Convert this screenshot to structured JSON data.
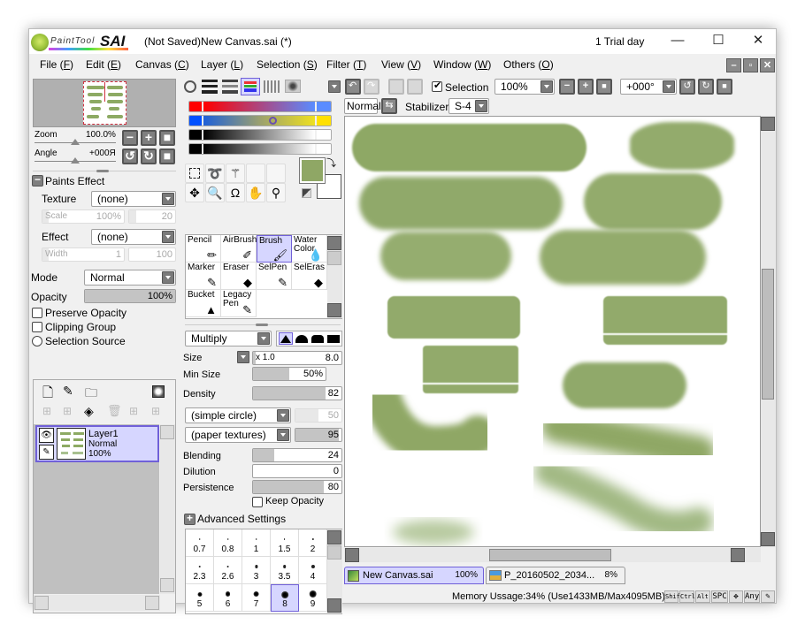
{
  "app": {
    "logo_text": "PaintTool",
    "logo_brand": "SAI",
    "title": "(Not Saved)New Canvas.sai (*)",
    "trial": "1 Trial day",
    "window_controls": {
      "minimize": "—",
      "maximize": "☐",
      "close": "✕"
    }
  },
  "menu": [
    {
      "label": "File",
      "key": "F"
    },
    {
      "label": "Edit",
      "key": "E"
    },
    {
      "label": "Canvas",
      "key": "C"
    },
    {
      "label": "Layer",
      "key": "L"
    },
    {
      "label": "Selection",
      "key": "S"
    },
    {
      "label": "Filter",
      "key": "T"
    },
    {
      "label": "View",
      "key": "V"
    },
    {
      "label": "Window",
      "key": "W"
    },
    {
      "label": "Others",
      "key": "O"
    }
  ],
  "navigator": {
    "zoom_label": "Zoom",
    "zoom_value": "100.0%",
    "angle_label": "Angle",
    "angle_value": "+000Я"
  },
  "paint_effect": {
    "header": "Paints Effect",
    "texture_label": "Texture",
    "texture_value": "(none)",
    "scale_label": "Scale",
    "scale_value": "100%",
    "scale_strength": "20",
    "effect_label": "Effect",
    "effect_value": "(none)",
    "width_label": "Width",
    "width_value": "1",
    "width_strength": "100"
  },
  "layer_props": {
    "mode_label": "Mode",
    "mode_value": "Normal",
    "opacity_label": "Opacity",
    "opacity_value": "100%",
    "opacity_fraction": 1.0,
    "preserve_opacity": "Preserve Opacity",
    "clipping_group": "Clipping Group",
    "selection_source": "Selection Source"
  },
  "layers": [
    {
      "name": "Layer1",
      "mode": "Normal",
      "opacity": "100%",
      "selected": true
    }
  ],
  "color": {
    "current": "#8fa765",
    "background": "#ffffff",
    "sliders": [
      {
        "left": "#ff0000",
        "right": "#5a8cff"
      },
      {
        "left": "#0050ff",
        "right": "#ffe000"
      },
      {
        "left": "#000000",
        "right": "#ffffff"
      },
      {
        "left": "#000000",
        "right": "#ffffff"
      }
    ]
  },
  "brush_tools": [
    {
      "label": "Pencil",
      "icon": "pencil-icon",
      "glyph": "✏"
    },
    {
      "label": "AirBrush",
      "icon": "airbrush-icon",
      "glyph": "✐"
    },
    {
      "label": "Brush",
      "icon": "brush-icon",
      "glyph": "🖌",
      "active": true
    },
    {
      "label": "Water Color",
      "icon": "watercolor-icon",
      "glyph": "💧"
    },
    {
      "label": "Marker",
      "icon": "marker-icon",
      "glyph": "✎"
    },
    {
      "label": "Eraser",
      "icon": "eraser-icon",
      "glyph": "◆"
    },
    {
      "label": "SelPen",
      "icon": "selpen-icon",
      "glyph": "✎"
    },
    {
      "label": "SelEras",
      "icon": "seleraser-icon",
      "glyph": "◆"
    },
    {
      "label": "Bucket",
      "icon": "bucket-icon",
      "glyph": "▲"
    },
    {
      "label": "Legacy Pen",
      "icon": "legacy-pen-icon",
      "glyph": "✎"
    }
  ],
  "brush_settings": {
    "blend_mode": "Multiply",
    "size_label": "Size",
    "size_multiplier": "x 1.0",
    "size_value": "8.0",
    "min_size_label": "Min Size",
    "min_size_value": "50%",
    "min_size_fraction": 0.5,
    "density_label": "Density",
    "density_value": "82",
    "density_fraction": 0.82,
    "shape_value": "(simple circle)",
    "shape_strength": "50",
    "texture_value": "(paper textures)",
    "texture_strength": "95",
    "blending_label": "Blending",
    "blending_value": "24",
    "blending_fraction": 0.24,
    "dilution_label": "Dilution",
    "dilution_value": "0",
    "dilution_fraction": 0,
    "persistence_label": "Persistence",
    "persistence_value": "80",
    "persistence_fraction": 0.8,
    "keep_opacity": "Keep Opacity",
    "advanced": "Advanced Settings"
  },
  "brush_sizes": [
    "0.7",
    "0.8",
    "1",
    "1.5",
    "2",
    "2.3",
    "2.6",
    "3",
    "3.5",
    "4",
    "5",
    "6",
    "7",
    "8",
    "9"
  ],
  "brush_size_selected": "8",
  "canvas_toolbar": {
    "selection_label": "Selection",
    "selection_checked": true,
    "zoom_value": "100%",
    "angle_value": "+000°",
    "blend_label": "Normal",
    "stabilizer_label": "Stabilizer",
    "stabilizer_value": "S-4"
  },
  "doc_tabs": [
    {
      "name": "New Canvas.sai",
      "zoom": "100%",
      "active": true
    },
    {
      "name": "P_20160502_2034...",
      "zoom": "8%",
      "active": false
    }
  ],
  "status": {
    "memory": "Memory Ussage:34% (Use1433MB/Max4095MB)",
    "keys": [
      "Shift",
      "Ctrl",
      "Alt",
      "SPC",
      "✥",
      "Any",
      "✎"
    ]
  }
}
